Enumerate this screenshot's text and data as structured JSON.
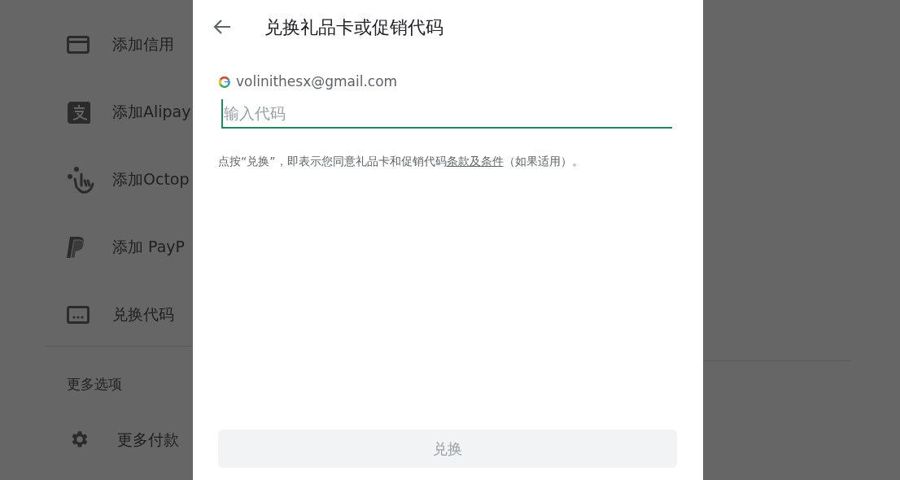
{
  "background_menu": {
    "items": [
      {
        "kind": "card",
        "label": "添加信用"
      },
      {
        "kind": "alipay",
        "label": "添加Alipay"
      },
      {
        "kind": "octopus",
        "label": "添加Octop"
      },
      {
        "kind": "paypal",
        "label": "添加 PayP"
      },
      {
        "kind": "code",
        "label": "兑换代码"
      }
    ],
    "section_title": "更多选项",
    "settings_item": {
      "label": "更多付款"
    }
  },
  "dialog": {
    "title": "兑换礼品卡或促销代码",
    "account": "volinithesx@gmail.com",
    "code_field": {
      "placeholder": "输入代码"
    },
    "terms": "点按“兑换”，即表示您同意礼品卡和促销代码",
    "terms_link": "条款及条件",
    "terms_tail": "（如果适用）。",
    "redeem_button": {
      "label": "兑换",
      "disabled": true
    }
  }
}
